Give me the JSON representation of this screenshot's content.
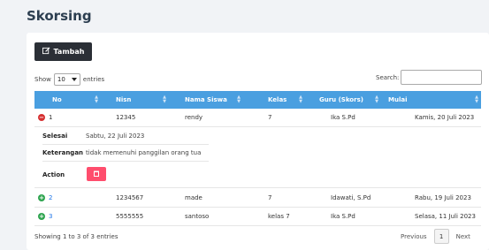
{
  "page": {
    "title": "Skorsing"
  },
  "toolbar": {
    "add_label": "Tambah",
    "add_icon": "edit-icon"
  },
  "length": {
    "show": "Show",
    "value": "10",
    "entries": "entries"
  },
  "search": {
    "label": "Search:",
    "value": ""
  },
  "columns": [
    "No",
    "Nisn",
    "Nama Siswa",
    "Kelas",
    "Guru (Skors)",
    "Mulai"
  ],
  "rows": [
    {
      "no": "1",
      "nisn": "12345",
      "nama": "rendy",
      "kelas": "7",
      "guru": "Ika S.Pd",
      "mulai": "Kamis, 20 Juli 2023",
      "expanded": true
    },
    {
      "no": "2",
      "nisn": "1234567",
      "nama": "made",
      "kelas": "7",
      "guru": "Idawati, S.Pd",
      "mulai": "Rabu, 19 Juli 2023",
      "expanded": false
    },
    {
      "no": "3",
      "nisn": "5555555",
      "nama": "santoso",
      "kelas": "kelas 7",
      "guru": "Ika S.Pd",
      "mulai": "Selasa, 11 Juli 2023",
      "expanded": false
    }
  ],
  "detail": {
    "selesai_label": "Selesai",
    "selesai_value": "Sabtu, 22 Juli 2023",
    "keterangan_label": "Keterangan",
    "keterangan_value": "tidak memenuhi panggilan orang tua",
    "action_label": "Action",
    "delete_icon": "trash-icon"
  },
  "footer": {
    "info": "Showing 1 to 3 of 3 entries",
    "previous": "Previous",
    "page": "1",
    "next": "Next"
  },
  "colors": {
    "header": "#4a9fe0",
    "add_button": "#2b2f36",
    "delete_button": "#ff4d6d",
    "collapse_toggle": "#d63031",
    "expand_toggle": "#2ea44f",
    "link": "#1a73e8"
  }
}
